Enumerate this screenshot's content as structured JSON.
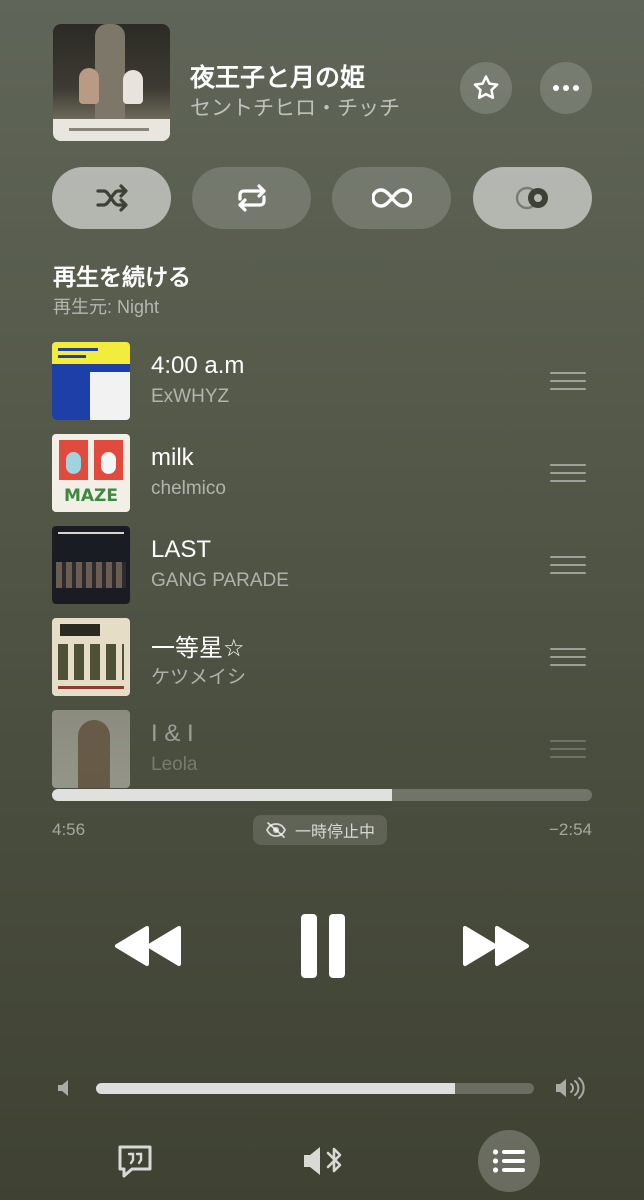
{
  "now_playing": {
    "title": "夜王子と月の姫",
    "artist": "セントチヒロ・チッチ"
  },
  "modes": [
    {
      "name": "shuffle",
      "active": true
    },
    {
      "name": "repeat",
      "active": false
    },
    {
      "name": "autoplay",
      "active": false
    },
    {
      "name": "crossfade",
      "active": true
    }
  ],
  "queue": {
    "title": "再生を続ける",
    "source": "再生元: Night",
    "tracks": [
      {
        "title": "4:00 a.m",
        "artist": "ExWHYZ"
      },
      {
        "title": "milk",
        "artist": "chelmico",
        "art_text": "MAZE"
      },
      {
        "title": "LAST",
        "artist": "GANG PARADE"
      },
      {
        "title": "一等星☆",
        "artist": "ケツメイシ"
      },
      {
        "title": "I & I",
        "artist": "Leola"
      }
    ]
  },
  "progress": {
    "elapsed": "4:56",
    "remaining": "−2:54",
    "fraction": 0.63,
    "status": "一時停止中"
  },
  "volume": {
    "level": 0.82
  },
  "colors": {
    "background": "#565b4c",
    "active_button": "#b7bab0"
  }
}
